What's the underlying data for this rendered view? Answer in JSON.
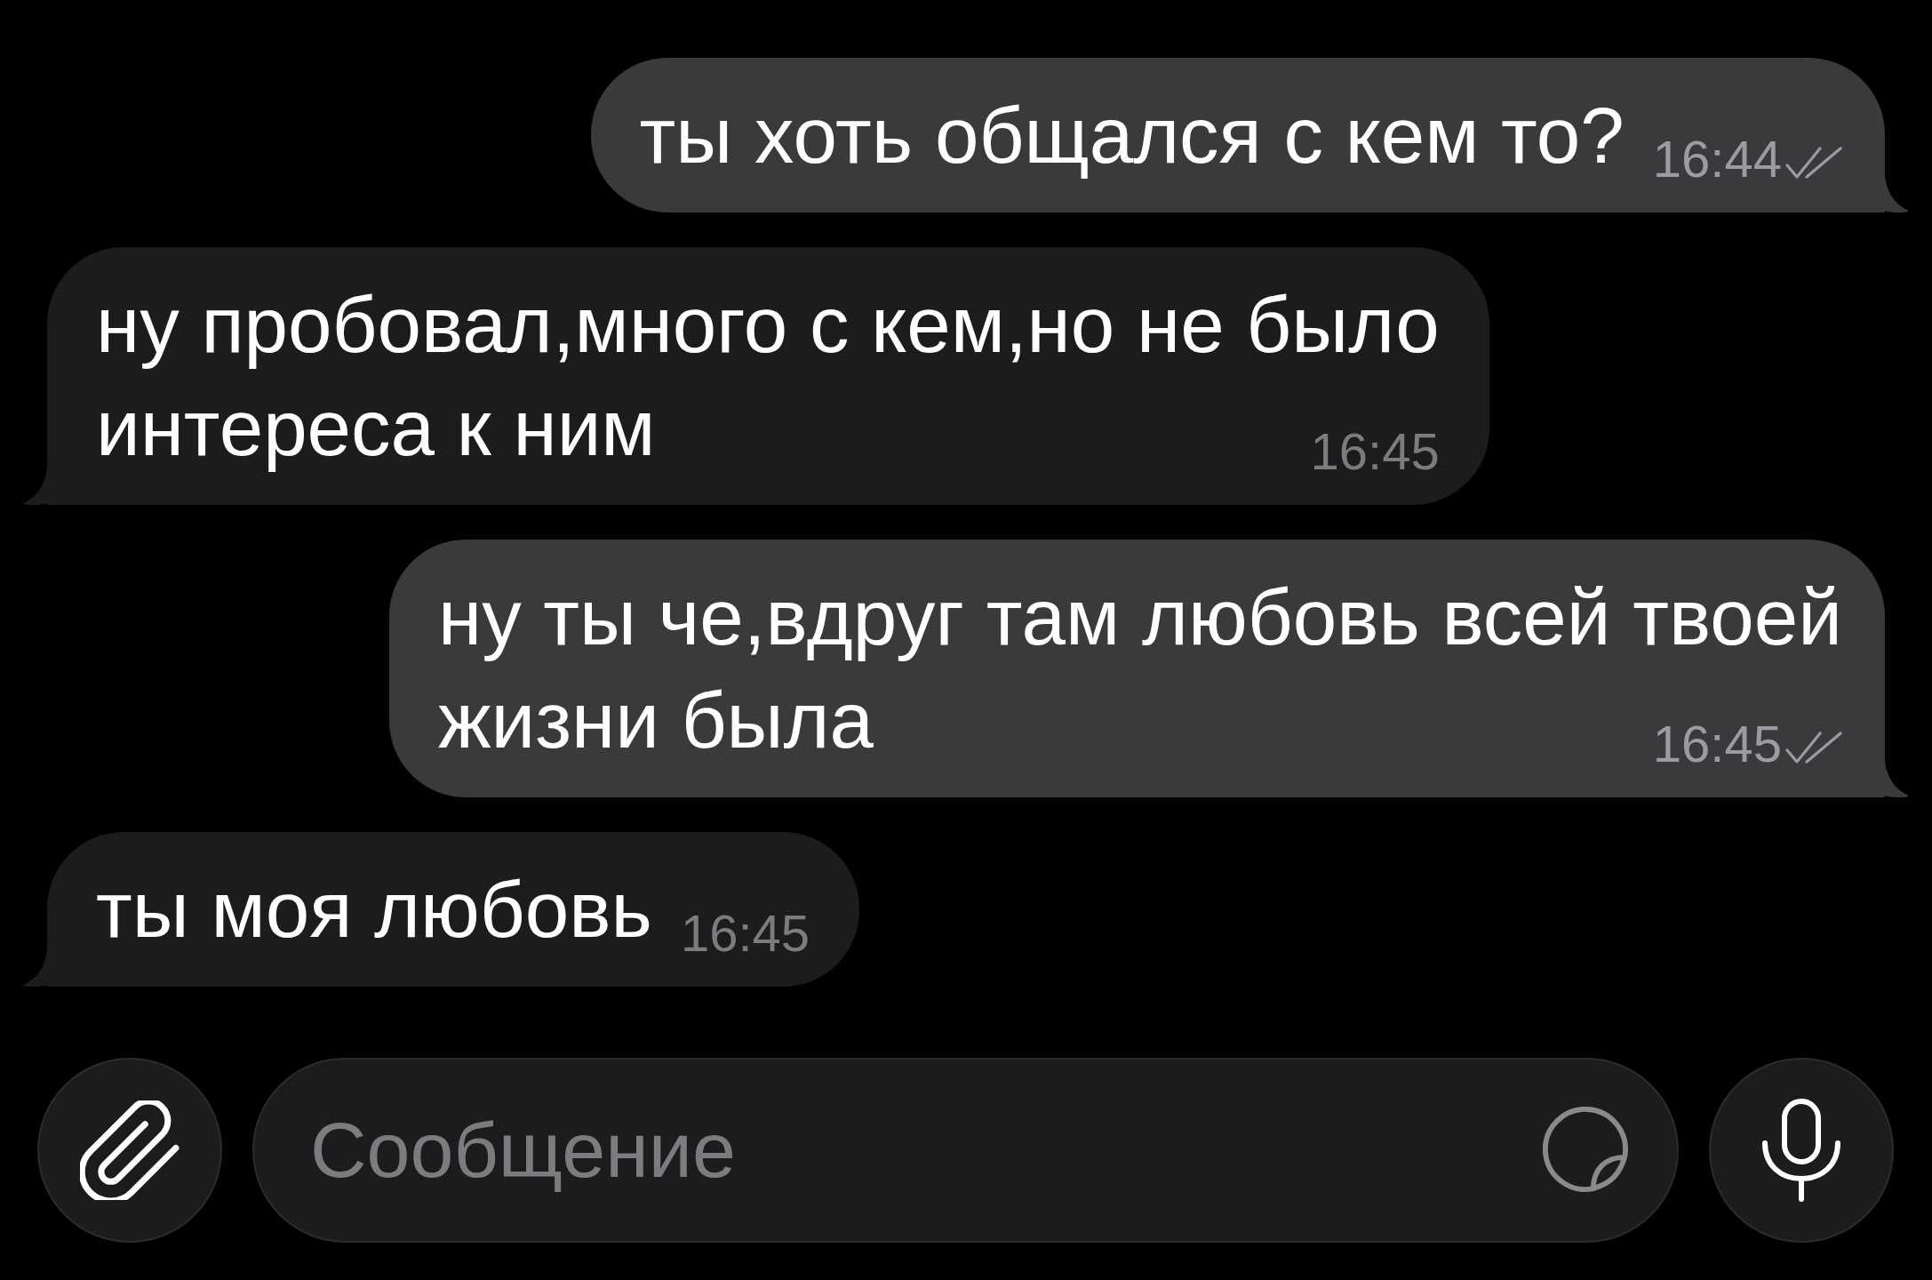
{
  "messages": [
    {
      "kind": "outgoing",
      "lines": [
        "ты хоть общался с кем то?"
      ],
      "time": "16:44",
      "read": true
    },
    {
      "kind": "incoming",
      "lines": [
        "ну пробовал,много с кем,но не было",
        "интереса к ним"
      ],
      "time": "16:45"
    },
    {
      "kind": "outgoing",
      "lines": [
        "ну ты че,вдруг там любовь всей твоей",
        "жизни была"
      ],
      "time": "16:45",
      "read": true
    },
    {
      "kind": "incoming",
      "lines": [
        "ты моя любовь"
      ],
      "time": "16:45"
    }
  ],
  "composer": {
    "placeholder": "Сообщение"
  }
}
